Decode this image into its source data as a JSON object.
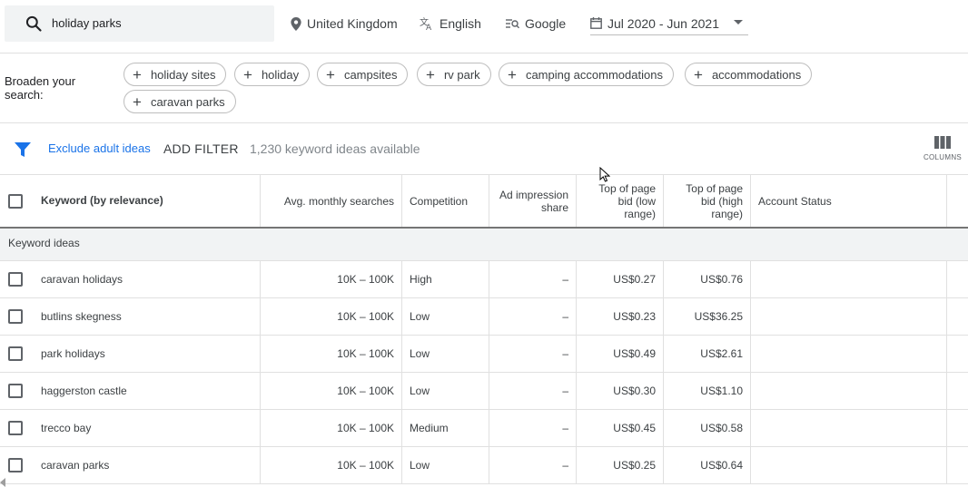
{
  "search": {
    "query": "holiday parks"
  },
  "filters": {
    "location": "United Kingdom",
    "language": "English",
    "network": "Google",
    "date_range": "Jul 2020 - Jun 2021"
  },
  "broaden": {
    "label": "Broaden your search:",
    "chips": [
      "holiday sites",
      "holiday",
      "campsites",
      "rv park",
      "camping accommodations",
      "accommodations",
      "caravan parks"
    ]
  },
  "toolbar": {
    "exclude_adult": "Exclude adult ideas",
    "add_filter": "ADD FILTER",
    "available": "1,230 keyword ideas available",
    "columns_label": "COLUMNS"
  },
  "table": {
    "headers": {
      "keyword": "Keyword (by relevance)",
      "avg_searches": "Avg. monthly searches",
      "competition": "Competition",
      "ad_share": "Ad impression share",
      "bid_low": "Top of page bid (low range)",
      "bid_high": "Top of page bid (high range)",
      "account_status": "Account Status"
    },
    "group_label": "Keyword ideas",
    "rows": [
      {
        "keyword": "caravan holidays",
        "searches": "10K – 100K",
        "competition": "High",
        "share": "–",
        "low": "US$0.27",
        "high": "US$0.76"
      },
      {
        "keyword": "butlins skegness",
        "searches": "10K – 100K",
        "competition": "Low",
        "share": "–",
        "low": "US$0.23",
        "high": "US$36.25"
      },
      {
        "keyword": "park holidays",
        "searches": "10K – 100K",
        "competition": "Low",
        "share": "–",
        "low": "US$0.49",
        "high": "US$2.61"
      },
      {
        "keyword": "haggerston castle",
        "searches": "10K – 100K",
        "competition": "Low",
        "share": "–",
        "low": "US$0.30",
        "high": "US$1.10"
      },
      {
        "keyword": "trecco bay",
        "searches": "10K – 100K",
        "competition": "Medium",
        "share": "–",
        "low": "US$0.45",
        "high": "US$0.58"
      },
      {
        "keyword": "caravan parks",
        "searches": "10K – 100K",
        "competition": "Low",
        "share": "–",
        "low": "US$0.25",
        "high": "US$0.64"
      }
    ]
  },
  "colors": {
    "accent": "#1a73e8",
    "text": "#3c4043",
    "muted": "#80868b",
    "search_bg": "#f1f3f4"
  }
}
